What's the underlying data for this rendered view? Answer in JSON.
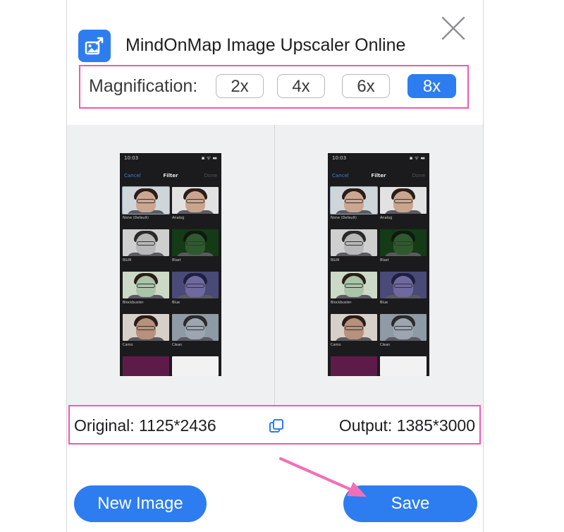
{
  "app": {
    "title": "MindOnMap Image Upscaler Online",
    "icon": "image-upscale-icon",
    "accent_color": "#2d7df0",
    "highlight_color": "#f05aa8"
  },
  "magnification": {
    "label": "Magnification:",
    "options": [
      {
        "label": "2x",
        "selected": false
      },
      {
        "label": "4x",
        "selected": false
      },
      {
        "label": "6x",
        "selected": false
      },
      {
        "label": "8x",
        "selected": true
      }
    ]
  },
  "preview": {
    "phone": {
      "time": "10:03",
      "status_icons": "▪ ᯤ ▬",
      "cancel": "Cancel",
      "title": "Filter",
      "done": "Done",
      "filters_left": [
        "None (Default)",
        "B&W",
        "Blockbuster",
        "Camo"
      ],
      "filters_right": [
        "Analog",
        "Blast",
        "Blue",
        "Clean"
      ]
    }
  },
  "info": {
    "original": "Original: 1125*2436",
    "output": "Output: 1385*3000",
    "copy_icon": "copy-icon"
  },
  "buttons": {
    "new_image": "New Image",
    "save": "Save"
  },
  "annotation": {
    "arrow_color": "#f26fb8"
  }
}
